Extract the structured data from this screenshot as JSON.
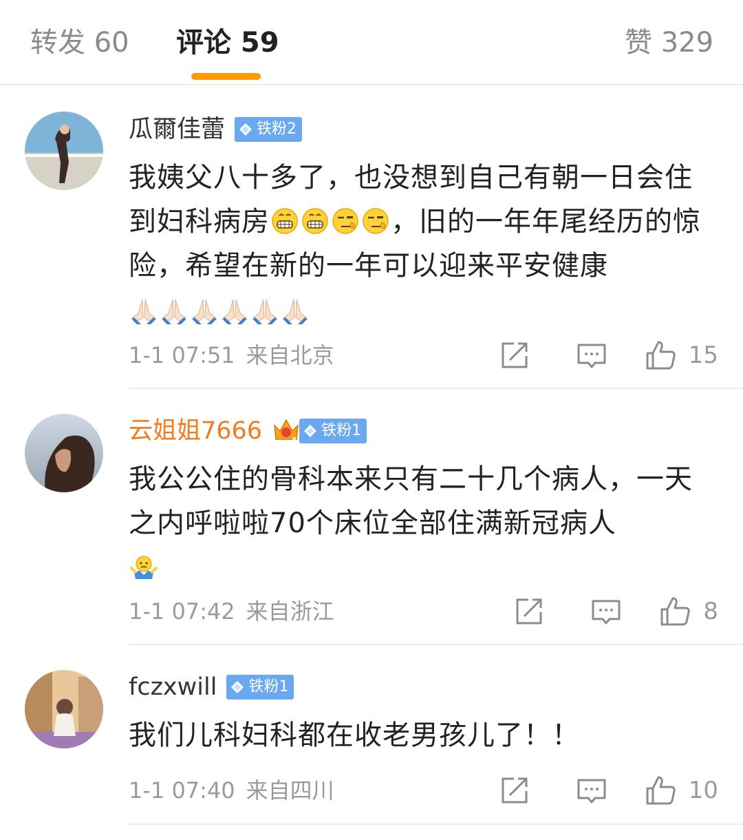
{
  "tabs": {
    "repost": "转发 60",
    "comments": "评论 59",
    "likes": "赞 329"
  },
  "colors": {
    "accent": "#ff9a00",
    "vip_name": "#f27c1c",
    "badge_bg": "#6aa8f2",
    "meta_text": "#9a9a9a"
  },
  "comments": [
    {
      "username": "瓜爾佳蕾",
      "badge": "铁粉2",
      "text_main": "我姨父八十多了，也没想到自己有朝一日会住到妇科病房",
      "text_after_emoji": "，旧的一年年尾经历的惊险，希望在新的一年可以迎来平安健康",
      "time": "1-1 07:51",
      "location": "来自北京",
      "likes": "15",
      "emojis_inline": [
        "grin-emoji",
        "grin-emoji",
        "smirk-emoji",
        "smirk-emoji"
      ],
      "emojis_line": [
        "pray-emoji",
        "pray-emoji",
        "pray-emoji",
        "pray-emoji",
        "pray-emoji",
        "pray-emoji"
      ]
    },
    {
      "username": "云姐姐7666",
      "badge": "铁粉1",
      "crown_level": "4",
      "text_main": "我公公住的骨科本来只有二十几个病人，一天之内呼啦啦70个床位全部住满新冠病人",
      "time": "1-1 07:42",
      "location": "来自浙江",
      "likes": "8",
      "emojis_line": [
        "shrug-emoji"
      ]
    },
    {
      "username": "fczxwill",
      "badge": "铁粉1",
      "text_main": "我们儿科妇科都在收老男孩儿了！！",
      "time": "1-1 07:40",
      "location": "来自四川",
      "likes": "10"
    }
  ]
}
